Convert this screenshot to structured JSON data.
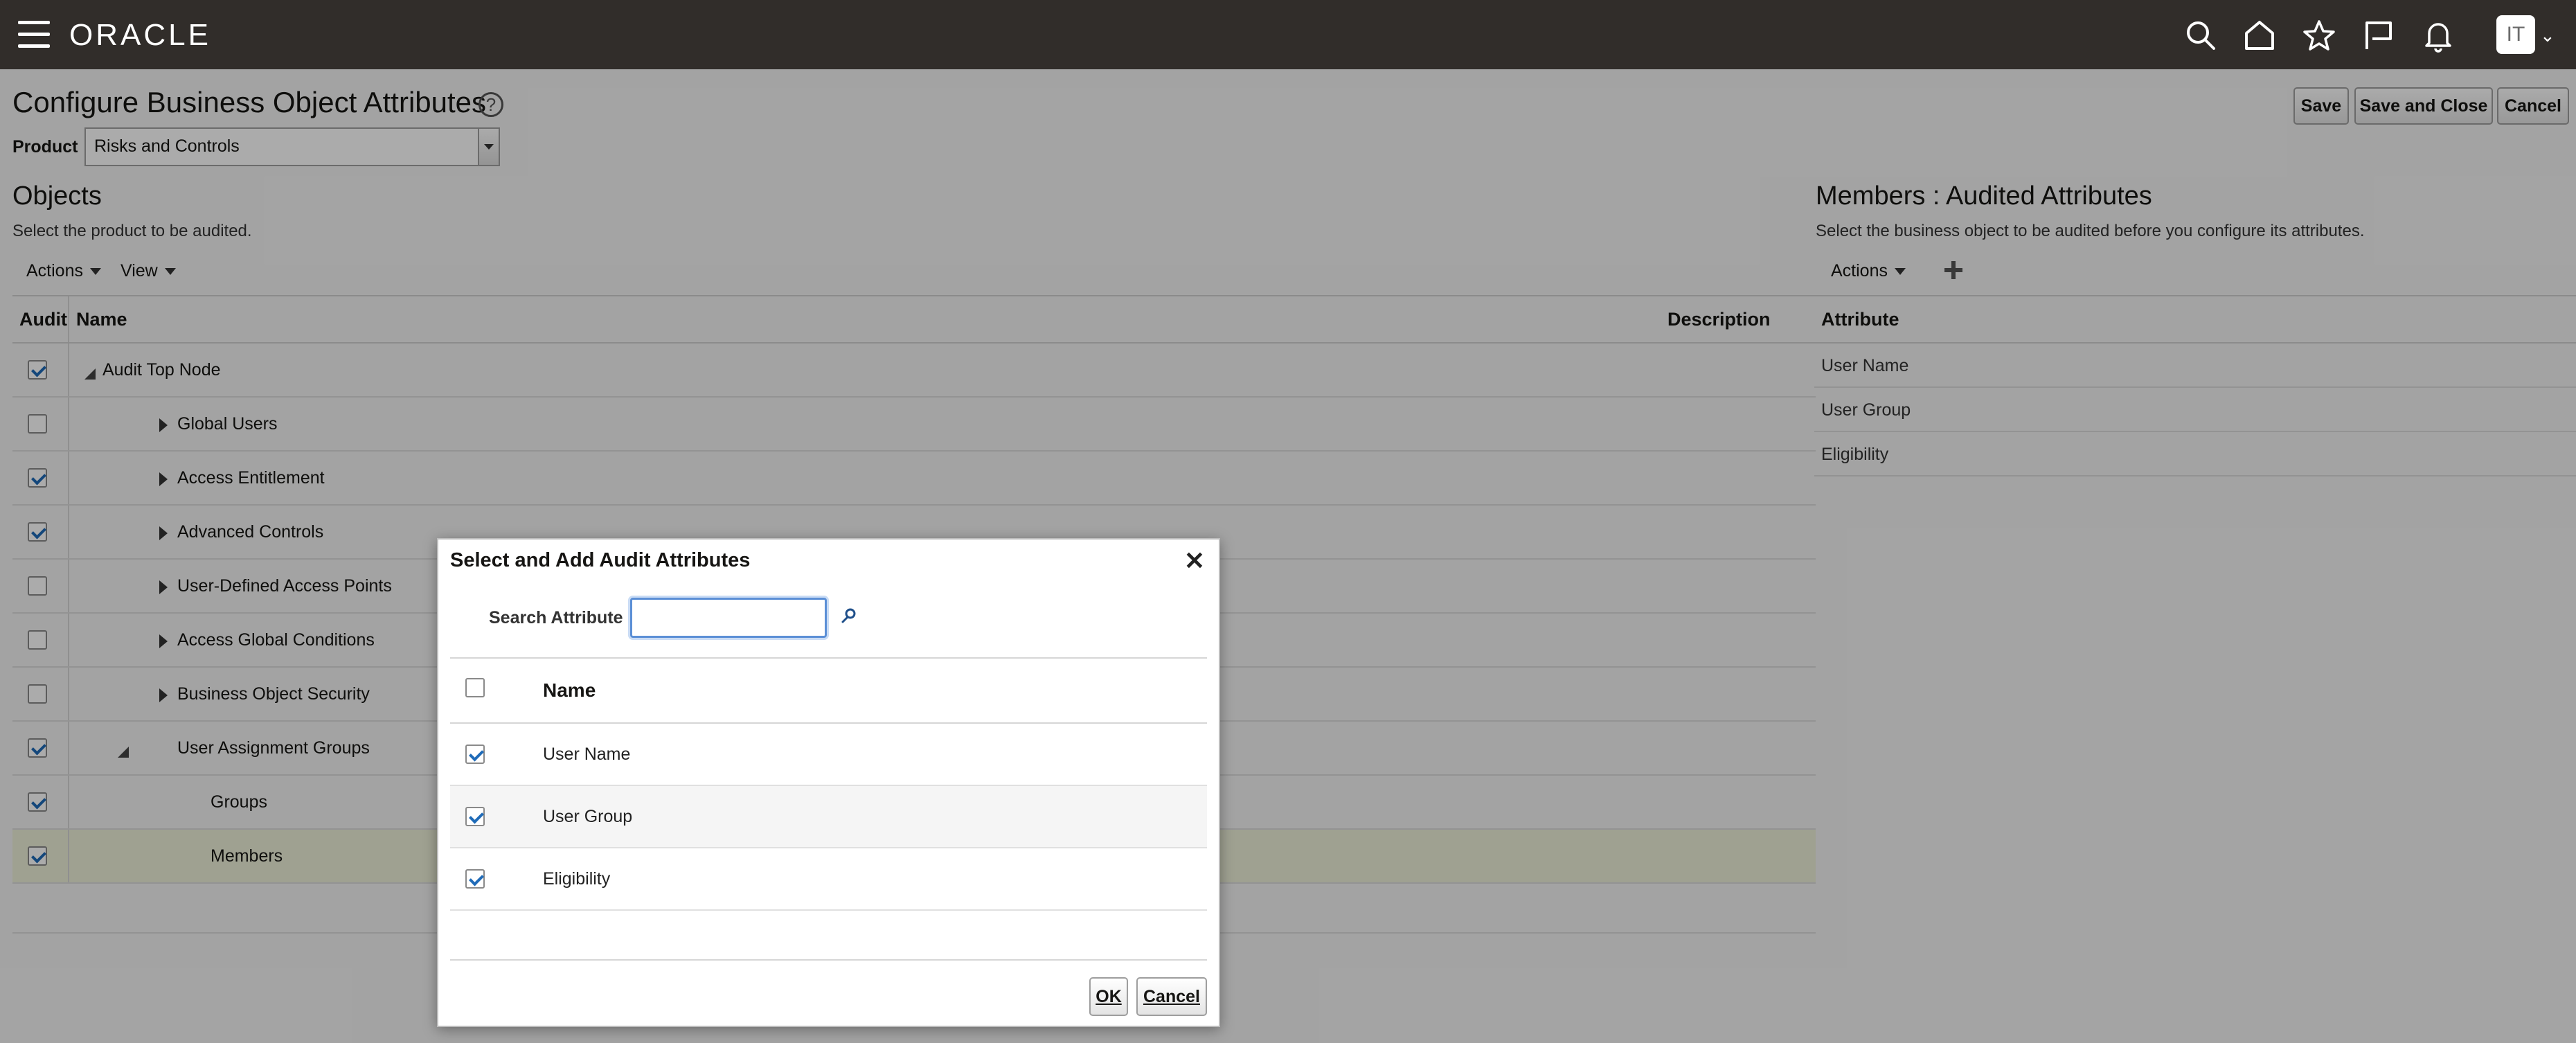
{
  "header": {
    "brand": "ORACLE",
    "user_initials": "IT",
    "icons": [
      "menu-icon",
      "search-icon",
      "home-icon",
      "favorites-star-icon",
      "flag-icon",
      "notifications-bell-icon"
    ]
  },
  "page": {
    "title": "Configure Business Object Attributes",
    "buttons": {
      "save": "Save",
      "save_close": "Save and Close",
      "cancel": "Cancel"
    },
    "product": {
      "label": "Product",
      "value": "Risks and Controls"
    }
  },
  "objects": {
    "title": "Objects",
    "subtitle": "Select the product to be audited.",
    "menus": {
      "actions": "Actions",
      "view": "View"
    },
    "columns": {
      "audit": "Audit",
      "name": "Name",
      "description": "Description"
    },
    "rows": [
      {
        "name": "Audit Top Node",
        "checked": true,
        "level": 0,
        "toggle": "expanded"
      },
      {
        "name": "Global Users",
        "checked": false,
        "level": 1,
        "toggle": "collapsed"
      },
      {
        "name": "Access Entitlement",
        "checked": true,
        "level": 1,
        "toggle": "collapsed"
      },
      {
        "name": "Advanced Controls",
        "checked": true,
        "level": 1,
        "toggle": "collapsed"
      },
      {
        "name": "User-Defined Access Points",
        "checked": false,
        "level": 1,
        "toggle": "collapsed"
      },
      {
        "name": "Access Global Conditions",
        "checked": false,
        "level": 1,
        "toggle": "collapsed"
      },
      {
        "name": "Business Object Security",
        "checked": false,
        "level": 1,
        "toggle": "collapsed"
      },
      {
        "name": "User Assignment Groups",
        "checked": true,
        "level": 1,
        "toggle": "expanded"
      },
      {
        "name": "Groups",
        "checked": true,
        "level": 2,
        "toggle": "none"
      },
      {
        "name": "Members",
        "checked": true,
        "level": 2,
        "toggle": "none",
        "selected": true
      }
    ]
  },
  "members": {
    "title": "Members : Audited Attributes",
    "subtitle": "Select the business object to be audited before you configure its attributes.",
    "menus": {
      "actions": "Actions"
    },
    "column": "Attribute",
    "rows": [
      "User Name",
      "User Group",
      "Eligibility"
    ]
  },
  "dialog": {
    "title": "Select and Add Audit Attributes",
    "search_label": "Search Attribute",
    "search_value": "",
    "column": "Name",
    "rows": [
      {
        "name": "User Name",
        "checked": true
      },
      {
        "name": "User Group",
        "checked": true
      },
      {
        "name": "Eligibility",
        "checked": true
      }
    ],
    "ok": "OK",
    "cancel": "Cancel"
  },
  "colors": {
    "topbar": "#312d2a",
    "checkmark": "#1f6bb8",
    "selected_row": "#eef1d9",
    "focus": "#5b8fd6"
  }
}
